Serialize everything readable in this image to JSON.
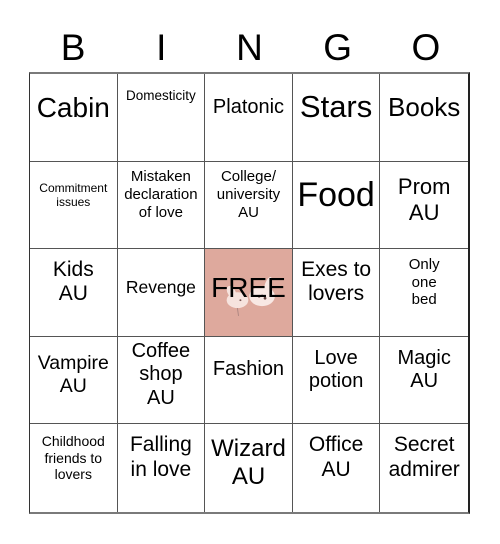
{
  "header": {
    "letters": [
      "B",
      "I",
      "N",
      "G",
      "O"
    ]
  },
  "free_cell": {
    "label": "FREE",
    "background_color": "#dea99d",
    "decoration": "bunny-illustration"
  },
  "grid": {
    "rows": [
      [
        "Cabin",
        "Domesticity",
        "Platonic",
        "Stars",
        "Books"
      ],
      [
        "Commitment issues",
        "Mistaken declaration of love",
        "College/ university AU",
        "Food",
        "Prom AU"
      ],
      [
        "Kids AU",
        "Revenge",
        "FREE",
        "Exes to lovers",
        "Only one bed"
      ],
      [
        "Vampire AU",
        "Coffee shop AU",
        "Fashion",
        "Love potion",
        "Magic AU"
      ],
      [
        "Childhood friends to lovers",
        "Falling in love",
        "Wizard AU",
        "Office AU",
        "Secret admirer"
      ]
    ]
  }
}
